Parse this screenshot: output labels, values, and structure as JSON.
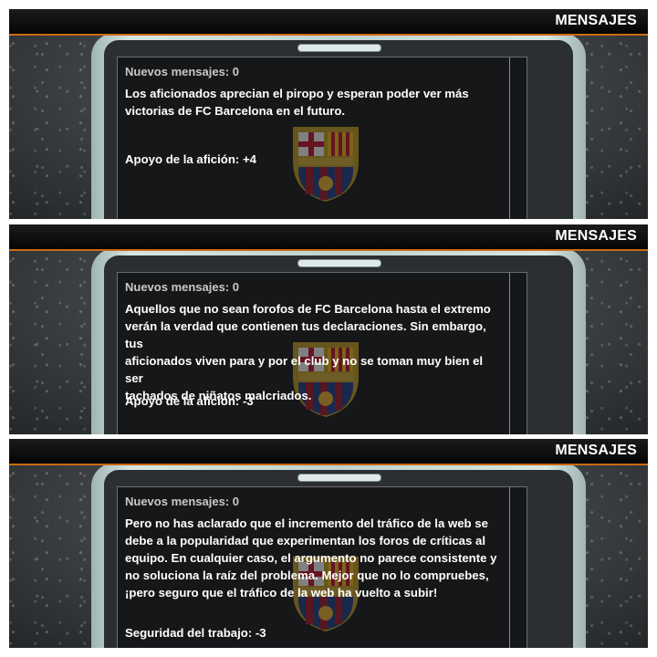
{
  "colors": {
    "header_accent": "#c96b12",
    "text": "#ffffff",
    "count_text": "#c9c9c9"
  },
  "panels": [
    {
      "header_title": "MENSAJES",
      "new_messages": "Nuevos mensajes: 0",
      "body": "Los aficionados aprecian el piropo y esperan poder ver más\nvictorias de FC Barcelona en el futuro.",
      "result": "Apoyo de la afición: +4",
      "crest_icon": "fc-barcelona-crest-icon"
    },
    {
      "header_title": "MENSAJES",
      "new_messages": "Nuevos mensajes: 0",
      "body": "Aquellos que no sean forofos de FC Barcelona hasta el extremo\nverán la verdad que contienen tus declaraciones. Sin embargo, tus\naficionados viven para y por el club y no se toman muy bien el ser\ntachados de niñatos malcriados.",
      "result": "Apoyo de la afición: -3",
      "crest_icon": "fc-barcelona-crest-icon"
    },
    {
      "header_title": "MENSAJES",
      "new_messages": "Nuevos mensajes: 0",
      "body": "Pero no has aclarado que el incremento del tráfico de la web se\ndebe a la popularidad que experimentan los foros de críticas al\nequipo. En cualquier caso, el argumento no parece consistente y\nno soluciona la raíz del problema. Mejor que no lo compruebes,\n¡pero seguro que el tráfico de la web ha vuelto a subir!",
      "result": "Seguridad del trabajo: -3",
      "crest_icon": "fc-barcelona-crest-icon"
    }
  ]
}
